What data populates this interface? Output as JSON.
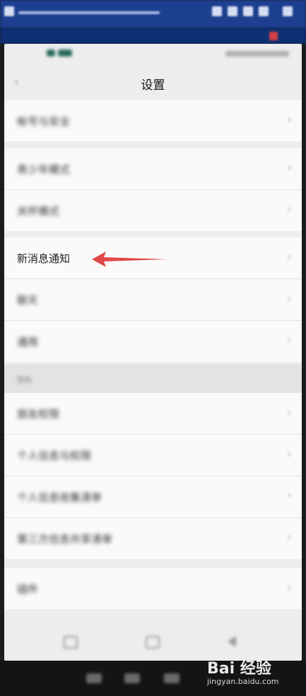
{
  "header": {
    "title": "设置",
    "back_icon": "chevron-left-icon"
  },
  "settings": {
    "group1": [
      {
        "label": "帐号与安全"
      }
    ],
    "group2": [
      {
        "label": "青少年模式"
      },
      {
        "label": "关怀模式"
      }
    ],
    "group3": [
      {
        "label": "新消息通知"
      },
      {
        "label": "聊天"
      },
      {
        "label": "通用"
      }
    ],
    "section_caption": "隐私",
    "group4": [
      {
        "label": "朋友权限"
      },
      {
        "label": "个人信息与权限"
      },
      {
        "label": "个人信息收集清单"
      },
      {
        "label": "第三方信息共享清单"
      }
    ],
    "group5": [
      {
        "label": "插件",
        "value": ""
      }
    ]
  },
  "annotation": {
    "arrow_color": "#e04848"
  },
  "watermark": {
    "brand": "Bai 经验",
    "url": "jingyan.baidu.com"
  },
  "colors": {
    "app_bar": "#1c3f8f",
    "page_bg": "#ededed"
  }
}
